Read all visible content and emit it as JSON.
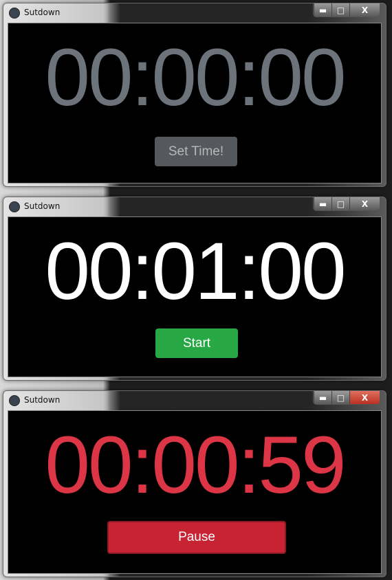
{
  "windows": [
    {
      "title": "Sutdown",
      "time": "00:00:00",
      "time_color": "#6c737b",
      "button": {
        "label": "Set Time!",
        "color": "#55585d",
        "text_color": "#b8b8b8"
      }
    },
    {
      "title": "Sutdown",
      "time": "00:01:00",
      "time_color": "#ffffff",
      "button": {
        "label": "Start",
        "color": "#28a745",
        "text_color": "#ffffff"
      }
    },
    {
      "title": "Sutdown",
      "time": "00:00:59",
      "time_color": "#dc3545",
      "button": {
        "label": "Pause",
        "color": "#c82333",
        "text_color": "#ffffff"
      }
    }
  ],
  "controls": {
    "minimize": "▬",
    "maximize": "□",
    "close": "X"
  }
}
